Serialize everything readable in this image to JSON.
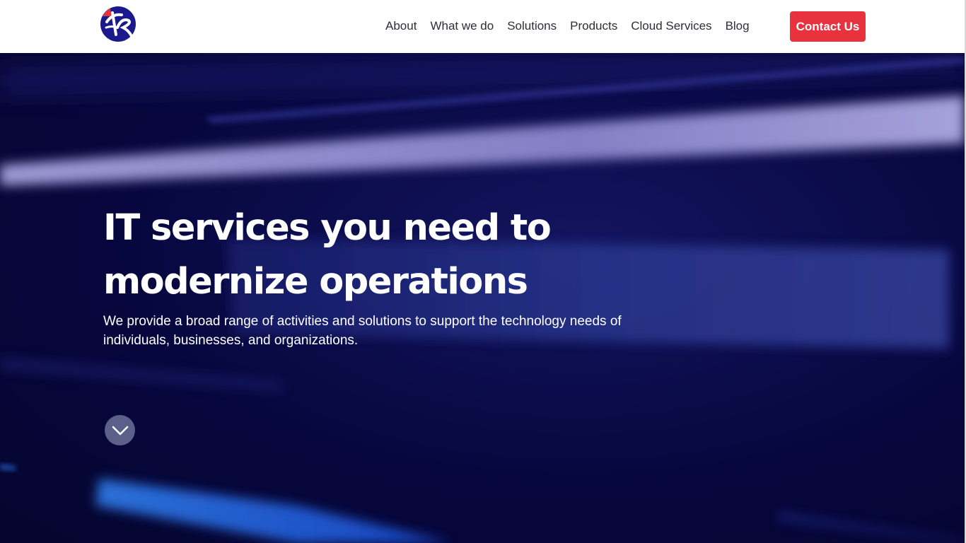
{
  "logo": {
    "icon": "company-logo-icon",
    "colors": {
      "primary": "#1a1a8c",
      "accent": "#e8333f"
    }
  },
  "nav": {
    "items": [
      {
        "label": "About"
      },
      {
        "label": "What we do"
      },
      {
        "label": "Solutions"
      },
      {
        "label": "Products"
      },
      {
        "label": "Cloud Services"
      },
      {
        "label": "Blog"
      }
    ],
    "cta_label": "Contact Us",
    "cta_color": "#e8333f"
  },
  "hero": {
    "title_line1": "IT services you need to",
    "title_line2": "modernize operations",
    "subtitle_line1": "We provide a broad range of activities and solutions to support the technology needs of",
    "subtitle_line2": "individuals, businesses, and organizations.",
    "scroll_icon": "chevron-down-icon",
    "background_color": "#06063f"
  }
}
